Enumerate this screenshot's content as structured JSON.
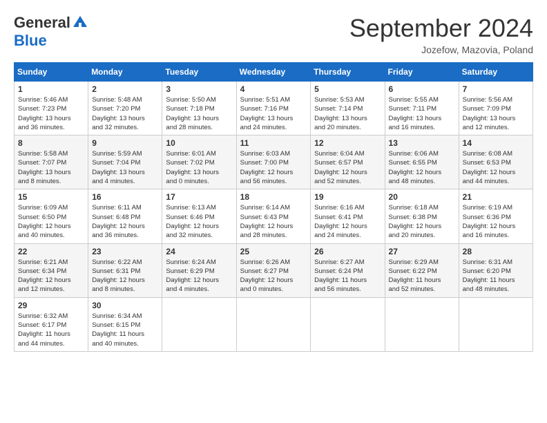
{
  "header": {
    "logo_general": "General",
    "logo_blue": "Blue",
    "month_title": "September 2024",
    "location": "Jozefow, Mazovia, Poland"
  },
  "weekdays": [
    "Sunday",
    "Monday",
    "Tuesday",
    "Wednesday",
    "Thursday",
    "Friday",
    "Saturday"
  ],
  "weeks": [
    [
      {
        "day": "1",
        "info": "Sunrise: 5:46 AM\nSunset: 7:23 PM\nDaylight: 13 hours\nand 36 minutes."
      },
      {
        "day": "2",
        "info": "Sunrise: 5:48 AM\nSunset: 7:20 PM\nDaylight: 13 hours\nand 32 minutes."
      },
      {
        "day": "3",
        "info": "Sunrise: 5:50 AM\nSunset: 7:18 PM\nDaylight: 13 hours\nand 28 minutes."
      },
      {
        "day": "4",
        "info": "Sunrise: 5:51 AM\nSunset: 7:16 PM\nDaylight: 13 hours\nand 24 minutes."
      },
      {
        "day": "5",
        "info": "Sunrise: 5:53 AM\nSunset: 7:14 PM\nDaylight: 13 hours\nand 20 minutes."
      },
      {
        "day": "6",
        "info": "Sunrise: 5:55 AM\nSunset: 7:11 PM\nDaylight: 13 hours\nand 16 minutes."
      },
      {
        "day": "7",
        "info": "Sunrise: 5:56 AM\nSunset: 7:09 PM\nDaylight: 13 hours\nand 12 minutes."
      }
    ],
    [
      {
        "day": "8",
        "info": "Sunrise: 5:58 AM\nSunset: 7:07 PM\nDaylight: 13 hours\nand 8 minutes."
      },
      {
        "day": "9",
        "info": "Sunrise: 5:59 AM\nSunset: 7:04 PM\nDaylight: 13 hours\nand 4 minutes."
      },
      {
        "day": "10",
        "info": "Sunrise: 6:01 AM\nSunset: 7:02 PM\nDaylight: 13 hours\nand 0 minutes."
      },
      {
        "day": "11",
        "info": "Sunrise: 6:03 AM\nSunset: 7:00 PM\nDaylight: 12 hours\nand 56 minutes."
      },
      {
        "day": "12",
        "info": "Sunrise: 6:04 AM\nSunset: 6:57 PM\nDaylight: 12 hours\nand 52 minutes."
      },
      {
        "day": "13",
        "info": "Sunrise: 6:06 AM\nSunset: 6:55 PM\nDaylight: 12 hours\nand 48 minutes."
      },
      {
        "day": "14",
        "info": "Sunrise: 6:08 AM\nSunset: 6:53 PM\nDaylight: 12 hours\nand 44 minutes."
      }
    ],
    [
      {
        "day": "15",
        "info": "Sunrise: 6:09 AM\nSunset: 6:50 PM\nDaylight: 12 hours\nand 40 minutes."
      },
      {
        "day": "16",
        "info": "Sunrise: 6:11 AM\nSunset: 6:48 PM\nDaylight: 12 hours\nand 36 minutes."
      },
      {
        "day": "17",
        "info": "Sunrise: 6:13 AM\nSunset: 6:46 PM\nDaylight: 12 hours\nand 32 minutes."
      },
      {
        "day": "18",
        "info": "Sunrise: 6:14 AM\nSunset: 6:43 PM\nDaylight: 12 hours\nand 28 minutes."
      },
      {
        "day": "19",
        "info": "Sunrise: 6:16 AM\nSunset: 6:41 PM\nDaylight: 12 hours\nand 24 minutes."
      },
      {
        "day": "20",
        "info": "Sunrise: 6:18 AM\nSunset: 6:38 PM\nDaylight: 12 hours\nand 20 minutes."
      },
      {
        "day": "21",
        "info": "Sunrise: 6:19 AM\nSunset: 6:36 PM\nDaylight: 12 hours\nand 16 minutes."
      }
    ],
    [
      {
        "day": "22",
        "info": "Sunrise: 6:21 AM\nSunset: 6:34 PM\nDaylight: 12 hours\nand 12 minutes."
      },
      {
        "day": "23",
        "info": "Sunrise: 6:22 AM\nSunset: 6:31 PM\nDaylight: 12 hours\nand 8 minutes."
      },
      {
        "day": "24",
        "info": "Sunrise: 6:24 AM\nSunset: 6:29 PM\nDaylight: 12 hours\nand 4 minutes."
      },
      {
        "day": "25",
        "info": "Sunrise: 6:26 AM\nSunset: 6:27 PM\nDaylight: 12 hours\nand 0 minutes."
      },
      {
        "day": "26",
        "info": "Sunrise: 6:27 AM\nSunset: 6:24 PM\nDaylight: 11 hours\nand 56 minutes."
      },
      {
        "day": "27",
        "info": "Sunrise: 6:29 AM\nSunset: 6:22 PM\nDaylight: 11 hours\nand 52 minutes."
      },
      {
        "day": "28",
        "info": "Sunrise: 6:31 AM\nSunset: 6:20 PM\nDaylight: 11 hours\nand 48 minutes."
      }
    ],
    [
      {
        "day": "29",
        "info": "Sunrise: 6:32 AM\nSunset: 6:17 PM\nDaylight: 11 hours\nand 44 minutes."
      },
      {
        "day": "30",
        "info": "Sunrise: 6:34 AM\nSunset: 6:15 PM\nDaylight: 11 hours\nand 40 minutes."
      },
      {
        "day": "",
        "info": ""
      },
      {
        "day": "",
        "info": ""
      },
      {
        "day": "",
        "info": ""
      },
      {
        "day": "",
        "info": ""
      },
      {
        "day": "",
        "info": ""
      }
    ]
  ]
}
